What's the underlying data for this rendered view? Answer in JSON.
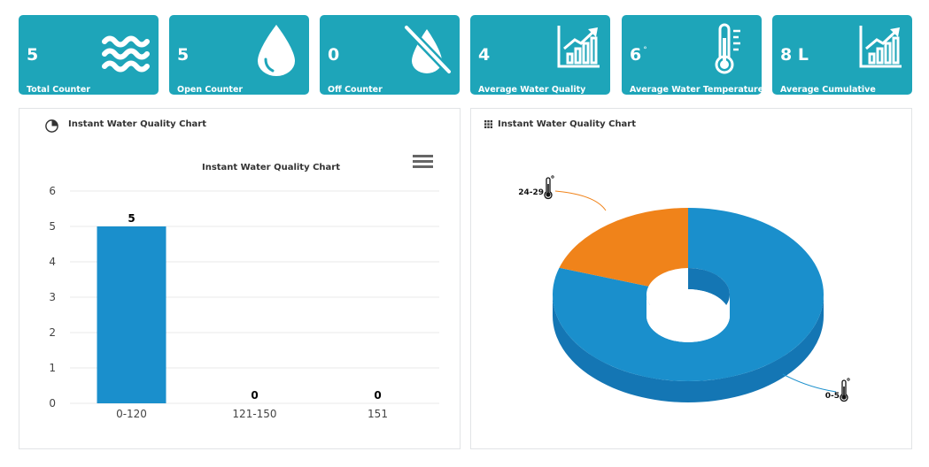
{
  "cards": [
    {
      "value": "5",
      "label": "Total Counter",
      "icon": "water-waves-icon"
    },
    {
      "value": "5",
      "label": "Open Counter",
      "icon": "water-drop-icon"
    },
    {
      "value": "0",
      "label": "Off Counter",
      "icon": "water-drop-off-icon"
    },
    {
      "value": "4",
      "label": "Average Water Quality",
      "icon": "growth-chart-icon"
    },
    {
      "value": "6",
      "unit": "°",
      "label": "Average Water Temperature",
      "icon": "thermometer-icon"
    },
    {
      "value": "8 L",
      "label": "Average Cumulative",
      "icon": "growth-chart-icon"
    }
  ],
  "left_panel": {
    "title": "Instant Water Quality Chart",
    "icon": "pie-chart-icon",
    "menu_icon": "hamburger-menu-icon"
  },
  "right_panel": {
    "title": "Instant Water Quality Chart",
    "icon": "grid-icon"
  },
  "colors": {
    "card": "#1ea5b9",
    "bar": "#1a8fcc",
    "pie_blue": "#1a8fcc",
    "pie_orange": "#f0831a"
  },
  "chart_data": [
    {
      "type": "bar",
      "title": "Instant Water Quality Chart",
      "categories": [
        "0-120",
        "121-150",
        "151"
      ],
      "values": [
        5,
        0,
        0
      ],
      "data_labels": [
        "5",
        "0",
        "0"
      ],
      "ylim": [
        0,
        6
      ],
      "yticks": [
        "0",
        "1",
        "2",
        "3",
        "4",
        "5",
        "6"
      ],
      "grid": true
    },
    {
      "type": "pie",
      "style": "3d-donut",
      "labels": [
        "0-5",
        "24-29"
      ],
      "values": [
        4,
        1
      ]
    }
  ]
}
